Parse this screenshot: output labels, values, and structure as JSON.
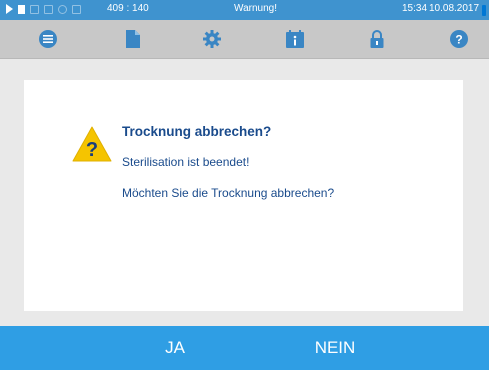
{
  "status": {
    "coords": "409 : 140",
    "warning": "Warnung!",
    "time": "15:34",
    "date": "10.08.2017",
    "icons": [
      "play-icon",
      "document-icon",
      "steam-icon",
      "graph-icon",
      "clock-icon",
      "lock-icon"
    ]
  },
  "toolbar": {
    "icons": [
      "menu-icon",
      "document-icon",
      "gear-icon",
      "info-icon",
      "lock-icon",
      "help-icon"
    ]
  },
  "dialog": {
    "title": "Trocknung abbrechen?",
    "line1": "Sterilisation ist beendet!",
    "line2": "Möchten Sie die Trocknung abbrechen?",
    "icon": "warning-question-icon",
    "warning_color": "#f5c400"
  },
  "actions": {
    "yes_label": "JA",
    "no_label": "NEIN"
  },
  "colors": {
    "status_bar": "#3f93cf",
    "toolbar": "#c8c8c8",
    "action_bar": "#2f9ee4",
    "dialog_text": "#1a4b8c"
  }
}
